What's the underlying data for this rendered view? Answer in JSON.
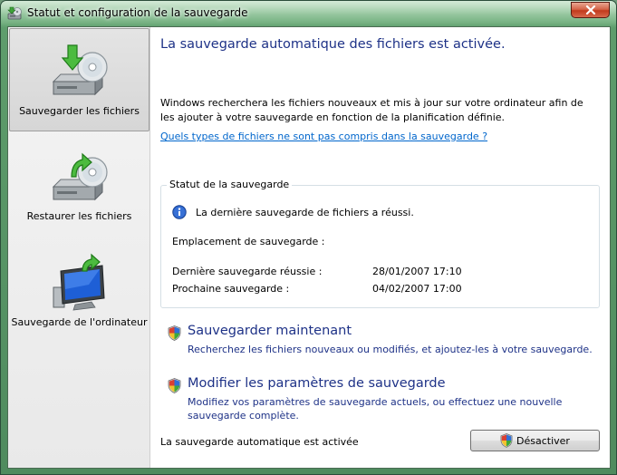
{
  "window": {
    "title": "Statut et configuration de la sauvegarde"
  },
  "sidebar": {
    "items": [
      {
        "label": "Sauvegarder les fichiers",
        "icon": "drive-backup-icon",
        "selected": true
      },
      {
        "label": "Restaurer les fichiers",
        "icon": "drive-restore-icon",
        "selected": false
      },
      {
        "label": "Sauvegarde de l'ordinateur",
        "icon": "computer-backup-icon",
        "selected": false
      }
    ]
  },
  "main": {
    "heading": "La sauvegarde automatique des fichiers est activée.",
    "description": "Windows recherchera les fichiers nouveaux et mis à jour sur votre ordinateur afin de les ajouter à votre sauvegarde en fonction de la planification définie.",
    "link": "Quels types de fichiers ne sont pas compris dans la sauvegarde ?",
    "status_group": {
      "legend": "Statut de la sauvegarde",
      "info_message": "La dernière sauvegarde de fichiers a réussi.",
      "location_label": "Emplacement de sauvegarde :",
      "last_label": "Dernière sauvegarde réussie :",
      "last_value": "28/01/2007 17:10",
      "next_label": "Prochaine sauvegarde :",
      "next_value": "04/02/2007 17:00"
    },
    "tasks": [
      {
        "title": "Sauvegarder maintenant",
        "description": "Recherchez les fichiers nouveaux ou modifiés, et ajoutez-les à votre sauvegarde."
      },
      {
        "title": "Modifier les paramètres de sauvegarde",
        "description": "Modifiez vos paramètres de sauvegarde actuels, ou effectuez une nouvelle sauvegarde complète."
      }
    ],
    "footer_status": "La sauvegarde automatique est activée",
    "disable_button": "Désactiver"
  },
  "colors": {
    "heading": "#1e3287",
    "link": "#0066cc",
    "frame": "#5e9d6c"
  }
}
